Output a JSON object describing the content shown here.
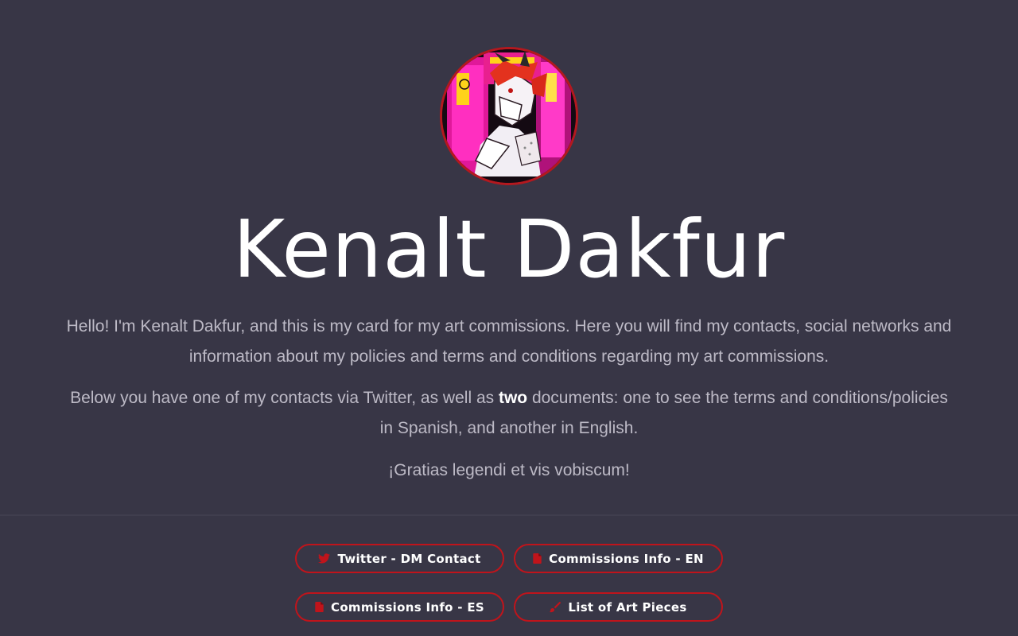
{
  "profile": {
    "name": "Kenalt Dakfur",
    "intro_p1": "Hello! I'm Kenalt Dakfur, and this is my card for my art commissions. Here you will find my contacts, social networks and information about my policies and terms and conditions regarding my art commissions.",
    "intro_p2_before": "Below you have one of my contacts via Twitter, as well as ",
    "intro_p2_bold": "two",
    "intro_p2_after": " documents: one to see the terms and conditions/policies in Spanish, and another in English.",
    "intro_p3": "¡Gratias legendi et vis vobiscum!"
  },
  "buttons": [
    {
      "label": "Twitter - DM Contact",
      "icon": "twitter-bird-icon"
    },
    {
      "label": "Commissions Info - EN",
      "icon": "document-icon"
    },
    {
      "label": "Commissions Info - ES",
      "icon": "document-icon"
    },
    {
      "label": "List of Art Pieces",
      "icon": "paintbrush-icon"
    }
  ],
  "colors": {
    "background": "#383646",
    "accent": "#c0141b",
    "text": "#bdbac6",
    "heading": "#ffffff"
  }
}
